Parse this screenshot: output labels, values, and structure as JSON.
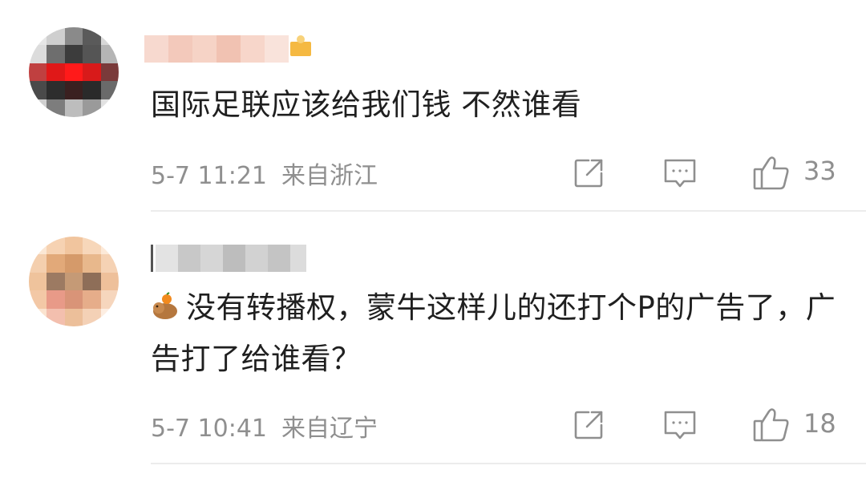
{
  "comments": [
    {
      "text": "国际足联应该给我们钱  不然谁看",
      "time": "5-7 11:21",
      "location": "来自浙江",
      "likes": "33",
      "icons": {
        "share": "share-icon",
        "comment": "comment-icon",
        "like": "thumbs-up-icon"
      }
    },
    {
      "emoji": "capybara-emoji",
      "text": "没有转播权，蒙牛这样儿的还打个P的广告了，广告打了给谁看？",
      "time": "5-7 10:41",
      "location": "来自辽宁",
      "likes": "18",
      "icons": {
        "share": "share-icon",
        "comment": "comment-icon",
        "like": "thumbs-up-icon"
      }
    }
  ],
  "colors": {
    "text": "#1f1f1f",
    "meta": "#8f8f8f",
    "divider": "#ececec",
    "badge": "#f5b942"
  }
}
